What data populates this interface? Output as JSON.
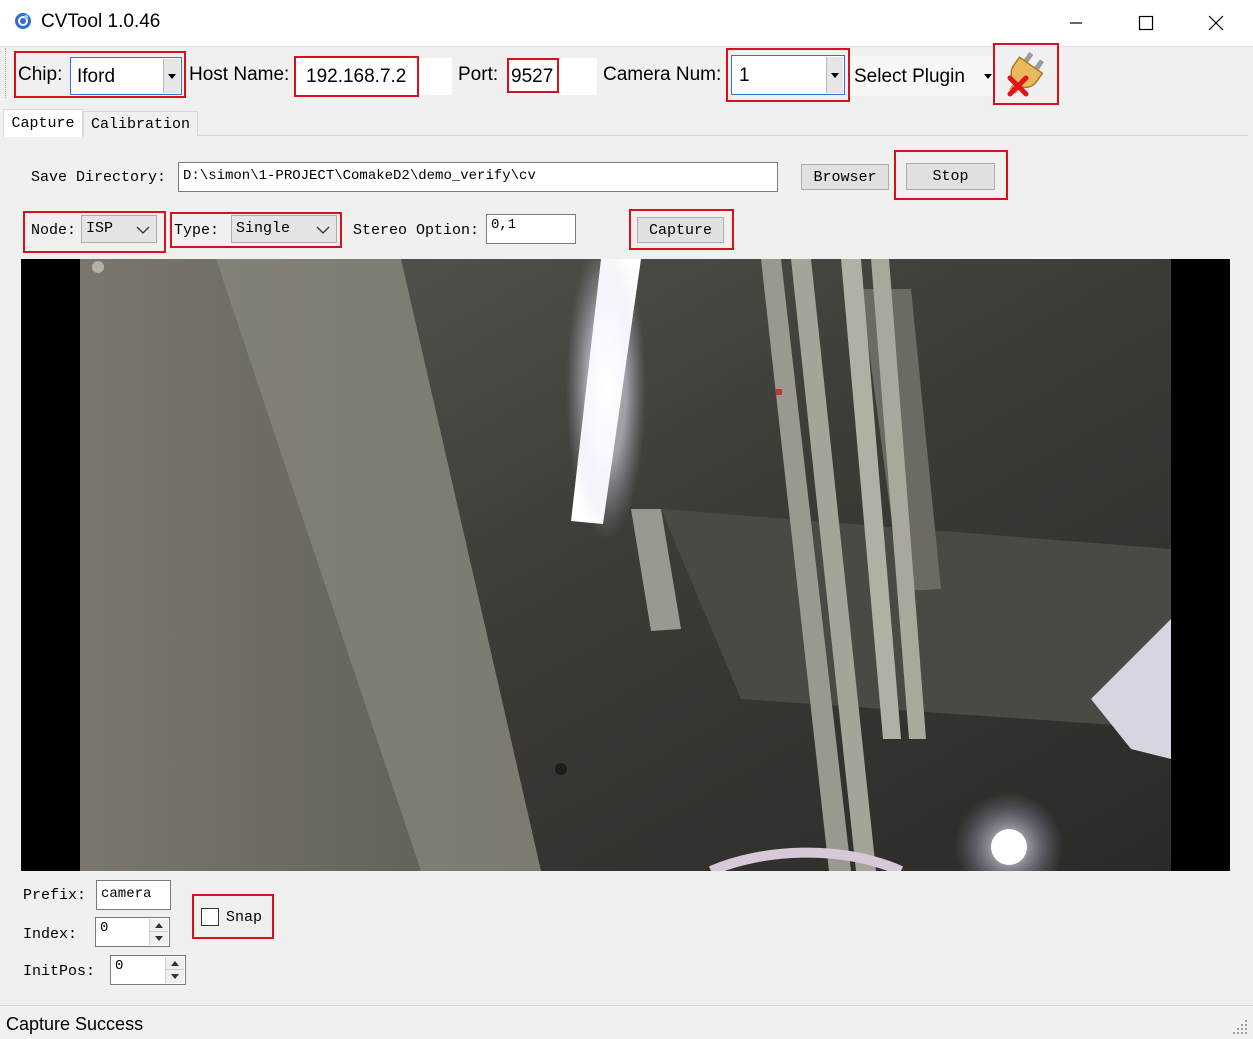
{
  "window": {
    "title": "CVTool 1.0.46"
  },
  "toolbar": {
    "chip_label": "Chip:",
    "chip_value": "Iford",
    "host_label": "Host Name:",
    "host_value": "192.168.7.2",
    "port_label": "Port:",
    "port_value": "9527",
    "camera_num_label": "Camera Num:",
    "camera_num_value": "1",
    "plugin_label": "Select Plugin"
  },
  "tabs": [
    {
      "label": "Capture",
      "active": true
    },
    {
      "label": "Calibration",
      "active": false
    }
  ],
  "capture": {
    "save_dir_label": "Save Directory:",
    "save_dir_value": "D:\\simon\\1-PROJECT\\ComakeD2\\demo_verify\\cv",
    "browser_label": "Browser",
    "stop_label": "Stop",
    "node_label": "Node:",
    "node_value": "ISP",
    "type_label": "Type:",
    "type_value": "Single",
    "stereo_label": "Stereo Option:",
    "stereo_value": "0,1",
    "capture_label": "Capture",
    "prefix_label": "Prefix:",
    "prefix_value": "camera",
    "index_label": "Index:",
    "index_value": "0",
    "initpos_label": "InitPos:",
    "initpos_value": "0",
    "snap_label": "Snap",
    "snap_checked": false
  },
  "status": {
    "text": "Capture Success"
  },
  "colors": {
    "highlight": "#d6111b",
    "focus_border": "#2a77d5"
  },
  "icons": {
    "app": "cvtool-app-icon",
    "plugin": "disconnected-plug-icon"
  }
}
